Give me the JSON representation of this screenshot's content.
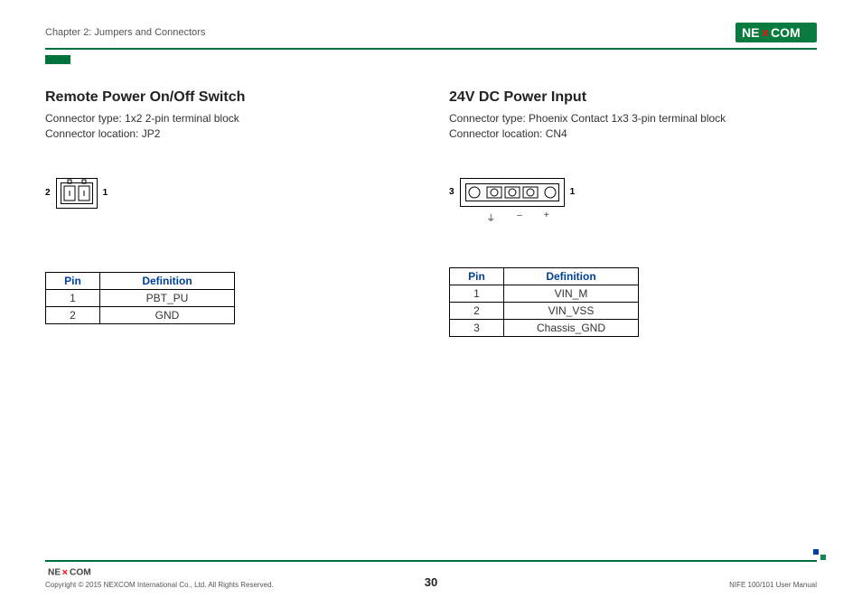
{
  "header": {
    "chapter": "Chapter 2: Jumpers and Connectors"
  },
  "left": {
    "title": "Remote Power On/Off Switch",
    "type_line": "Connector type: 1x2 2-pin terminal block",
    "loc_line": "Connector location: JP2",
    "pin2_label": "2",
    "pin1_label": "1",
    "table": {
      "head_pin": "Pin",
      "head_def": "Definition",
      "rows": [
        {
          "pin": "1",
          "def": "PBT_PU"
        },
        {
          "pin": "2",
          "def": "GND"
        }
      ]
    }
  },
  "right": {
    "title": "24V DC Power Input",
    "type_line": "Connector type: Phoenix Contact 1x3 3-pin terminal block",
    "loc_line": "Connector location: CN4",
    "pin3_label": "3",
    "pin1_label": "1",
    "polarity": {
      "gnd": "⏚",
      "minus": "–",
      "plus": "+"
    },
    "table": {
      "head_pin": "Pin",
      "head_def": "Definition",
      "rows": [
        {
          "pin": "1",
          "def": "VIN_M"
        },
        {
          "pin": "2",
          "def": "VIN_VSS"
        },
        {
          "pin": "3",
          "def": "Chassis_GND"
        }
      ]
    }
  },
  "footer": {
    "copyright": "Copyright © 2015 NEXCOM International Co., Ltd. All Rights Reserved.",
    "page": "30",
    "doc": "NIFE 100/101 User Manual"
  }
}
